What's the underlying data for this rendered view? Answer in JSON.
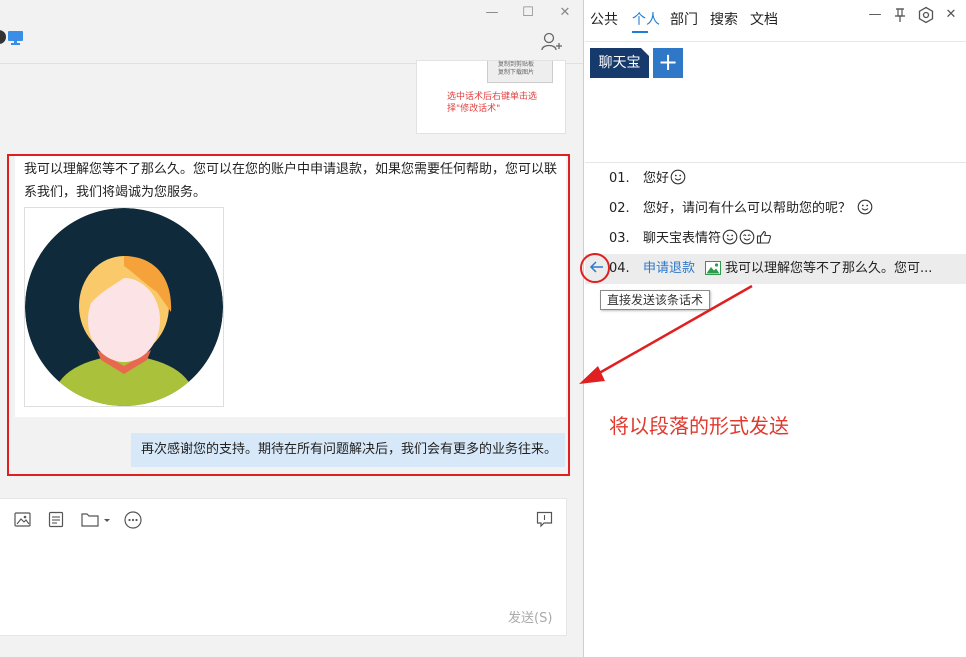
{
  "chat": {
    "quoted_card": {
      "menu_line1": "复制到剪贴板",
      "menu_line2": "复制下载图片",
      "hint": "选中话术后右键单击选择\"修改话术\""
    },
    "message_text": "我可以理解您等不了那么久。您可以在您的账户中申请退款，如果您需要任何帮助，您可以联系我们，我们将竭诚为您服务。",
    "message_followup": "再次感谢您的支持。期待在所有问题解决后，我们会有更多的业务往来。",
    "send_label": "发送(S)"
  },
  "panel": {
    "tabs": [
      "公共",
      "个人",
      "部门",
      "搜索",
      "文档"
    ],
    "active_tab": "个人",
    "group_label": "聊天宝",
    "add_label": "+",
    "phrases": [
      {
        "num": "01.",
        "text": "您好"
      },
      {
        "num": "02.",
        "text": "您好，请问有什么可以帮助您的呢？"
      },
      {
        "num": "03.",
        "text": "聊天宝表情符"
      },
      {
        "num": "04.",
        "keyword": "申请退款",
        "text": "我可以理解您等不了那么久。您可..."
      }
    ],
    "tooltip": "直接发送该条话术"
  },
  "annotation": "将以段落的形式发送",
  "colors": {
    "accent": "#1e7fd6",
    "highlight_red": "#e02020",
    "group_bg": "#163a6b",
    "bubble_blue": "#d7e8f8"
  }
}
